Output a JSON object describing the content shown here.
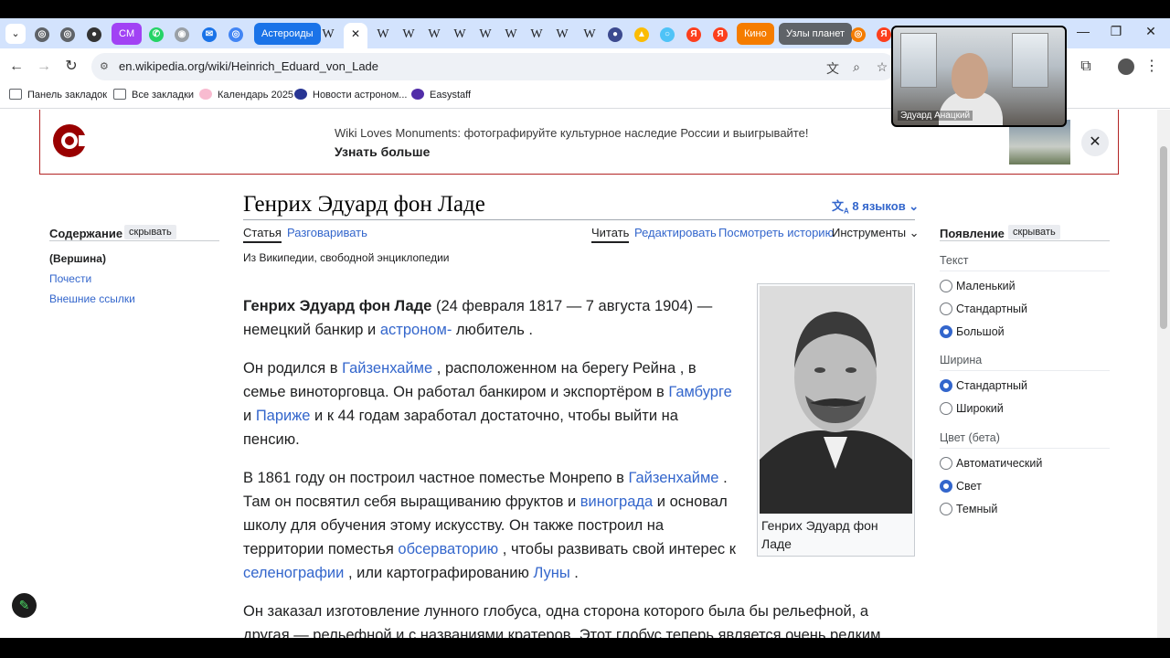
{
  "browser": {
    "tabs": {
      "asteroids": "Астероиды",
      "kino": "Кино",
      "uzly": "Узлы планет",
      "cm": "CM",
      "w": "W",
      "ya": "Я"
    },
    "url": "en.wikipedia.org/wiki/Heinrich_Eduard_von_Lade",
    "bookmarks": [
      "Панель закладок",
      "Все закладки",
      "Календарь 2025",
      "Новости астроном...",
      "Easystaff"
    ]
  },
  "banner": {
    "message": "Wiki Loves Monuments: фотографируйте культурное наследие России и выигрывайте!",
    "more": "Узнать больше"
  },
  "toc": {
    "heading": "Содержание",
    "hide": "скрывать",
    "items": [
      "(Вершина)",
      "Почести",
      "Внешние ссылки"
    ]
  },
  "article": {
    "title": "Генрих Эдуард фон Ладе",
    "languages": "8 языков",
    "tabs": {
      "article": "Статья",
      "talk": "Разговаривать",
      "read": "Читать",
      "edit": "Редактировать",
      "history": "Посмотреть историю",
      "tools": "Инструменты"
    },
    "from": "Из Википедии, свободной энциклопедии",
    "p1": {
      "bold": "Генрих Эдуард фон Ладе",
      "t1": " (24 февраля 1817 — 7 августа 1904) — немецкий банкир и ",
      "link1": "астроном-",
      "t2": " любитель ."
    },
    "p2": {
      "t1": "Он родился в ",
      "link1": "Гайзенхайме",
      "t2": " , расположенном на берегу Рейна , в семье виноторговца. Он работал банкиром и экспортёром в ",
      "link2": "Гамбурге",
      "t3": " и ",
      "link3": "Париже",
      "t4": " и к 44 годам заработал достаточно, чтобы выйти на пенсию."
    },
    "p3": {
      "t1": "В 1861 году он построил частное поместье Монрепо в ",
      "link1": "Гайзенхайме",
      "t2": " . Там он посвятил себя выращиванию фруктов и ",
      "link2": "винограда",
      "t3": " и основал школу для обучения этому искусству. Он также построил на территории поместья ",
      "link3": "обсерваторию",
      "t4": " , чтобы развивать свой интерес к ",
      "link4": "селенографии",
      "t5": " , или картографированию ",
      "link5": "Луны",
      "t6": " ."
    },
    "p4": "Он заказал изготовление лунного глобуса, одна сторона которого была бы рельефной, а другая — рельефной и с названиями кратеров. Этот глобус теперь является очень редким",
    "caption": "Генрих Эдуард фон Ладе"
  },
  "appearance": {
    "heading": "Появление",
    "hide": "скрывать",
    "text_group": "Текст",
    "text_options": [
      "Маленький",
      "Стандартный",
      "Большой"
    ],
    "width_group": "Ширина",
    "width_options": [
      "Стандартный",
      "Широкий"
    ],
    "color_group": "Цвет (бета)",
    "color_options": [
      "Автоматический",
      "Свет",
      "Темный"
    ]
  },
  "webcam": {
    "name": "Эдуард Анацкий"
  }
}
